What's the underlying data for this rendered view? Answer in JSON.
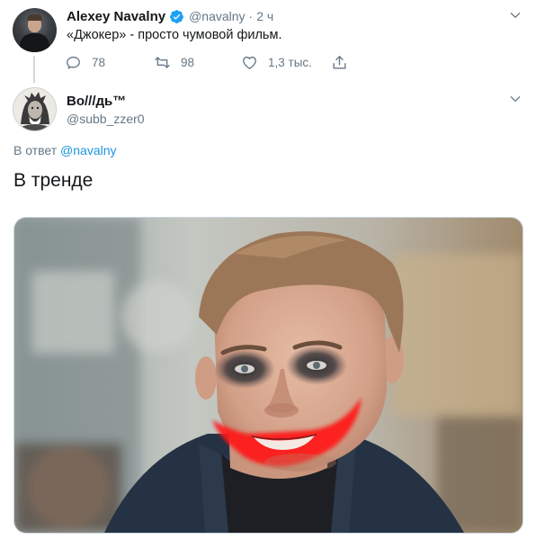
{
  "original_tweet": {
    "author_name": "Alexey Navalny",
    "handle": "@navalny",
    "separator": "·",
    "time": "2 ч",
    "text": "«Джокер» - просто чумовой фильм.",
    "verified": true,
    "actions": {
      "replies": "78",
      "retweets": "98",
      "likes": "1,3 тыс."
    }
  },
  "reply_tweet": {
    "author_name": "Во///дь™",
    "handle": "@subb_zzer0",
    "reply_prefix": "В ответ",
    "reply_mention": "@navalny",
    "text": "В тренде",
    "media": "photo"
  },
  "icons": {
    "verified": "verified-badge-icon",
    "reply": "reply-icon",
    "retweet": "retweet-icon",
    "like": "heart-icon",
    "share": "share-icon",
    "menu": "chevron-down-icon"
  },
  "colors": {
    "accent": "#1da1f2",
    "link": "#1b95e0",
    "secondary_text": "#657786",
    "primary_text": "#14171a",
    "joker_smile": "#ff1a1a"
  }
}
